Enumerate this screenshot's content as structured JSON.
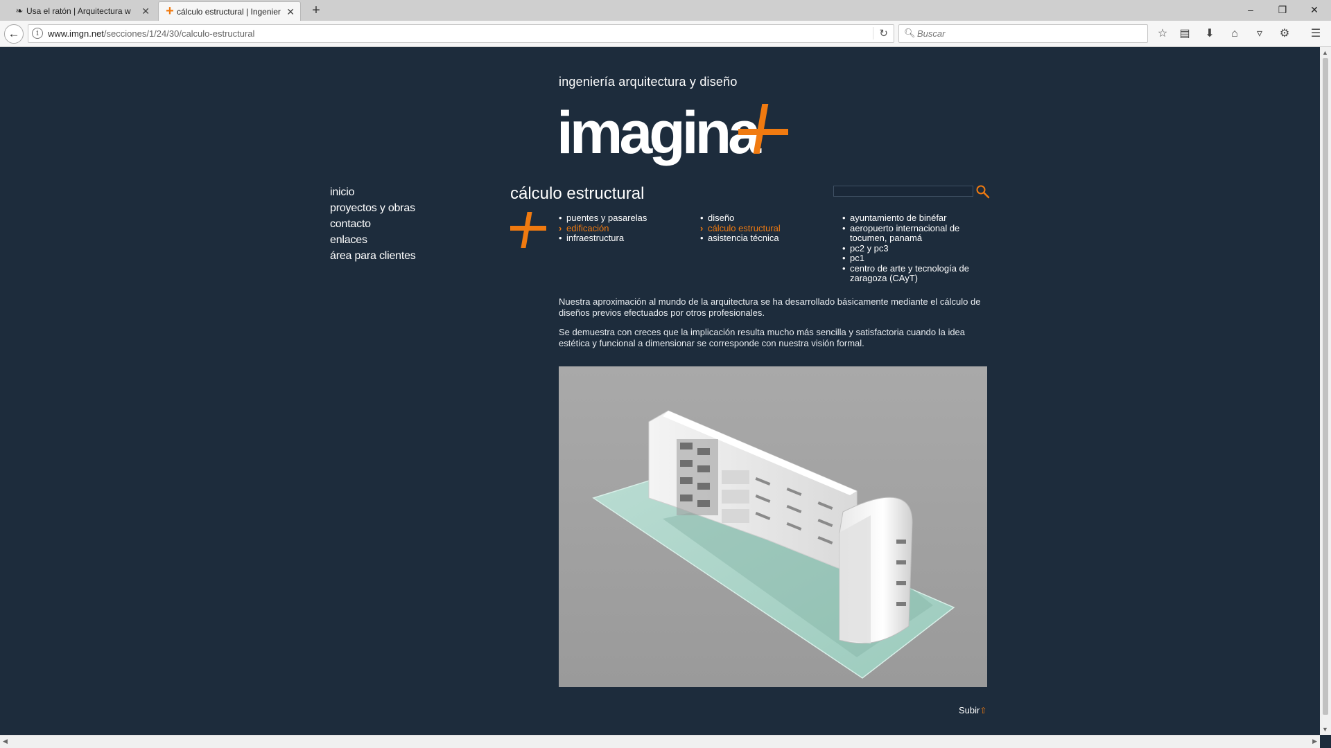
{
  "browser": {
    "tabs": [
      {
        "title": "Usa el ratón | Arquitectura w",
        "active": false,
        "icon": "bird-icon"
      },
      {
        "title": "cálculo estructural | Ingenier",
        "active": true,
        "icon": "plus-icon"
      }
    ],
    "url_host": "www.imgn.net",
    "url_path": "/secciones/1/24/30/calculo-estructural",
    "search_placeholder": "Buscar"
  },
  "site": {
    "tagline": "ingeniería arquitectura y diseño",
    "logo_text": "imagina",
    "accent_color": "#f07a10",
    "background_color": "#1d2c3c"
  },
  "sidenav": [
    "inicio",
    "proyectos y obras",
    "contacto",
    "enlaces",
    "área para clientes"
  ],
  "section": {
    "title": "cálculo estructural",
    "col1": [
      {
        "label": "puentes y pasarelas",
        "active": false
      },
      {
        "label": "edificación",
        "active": true
      },
      {
        "label": "infraestructura",
        "active": false
      }
    ],
    "col2": [
      {
        "label": "diseño",
        "active": false
      },
      {
        "label": "cálculo estructural",
        "active": true
      },
      {
        "label": "asistencia técnica",
        "active": false
      }
    ],
    "col3": [
      {
        "label": "ayuntamiento de binéfar",
        "active": false
      },
      {
        "label": "aeropuerto internacional de tocumen, panamá",
        "active": false
      },
      {
        "label": "pc2 y pc3",
        "active": false
      },
      {
        "label": "pc1",
        "active": false
      },
      {
        "label": "centro de arte y tecnología de zaragoza (CAyT)",
        "active": false
      }
    ]
  },
  "content": {
    "paragraph1": "Nuestra aproximación al mundo de la arquitectura se ha desarrollado básicamente mediante el cálculo de diseños previos efectuados por otros profesionales.",
    "paragraph2": "Se demuestra con creces que la implicación resulta mucho más sencilla y satisfactoria cuando la idea estética y funcional a dimensionar se corresponde con nuestra visión formal."
  },
  "footer": {
    "subir_label": "Subir"
  }
}
